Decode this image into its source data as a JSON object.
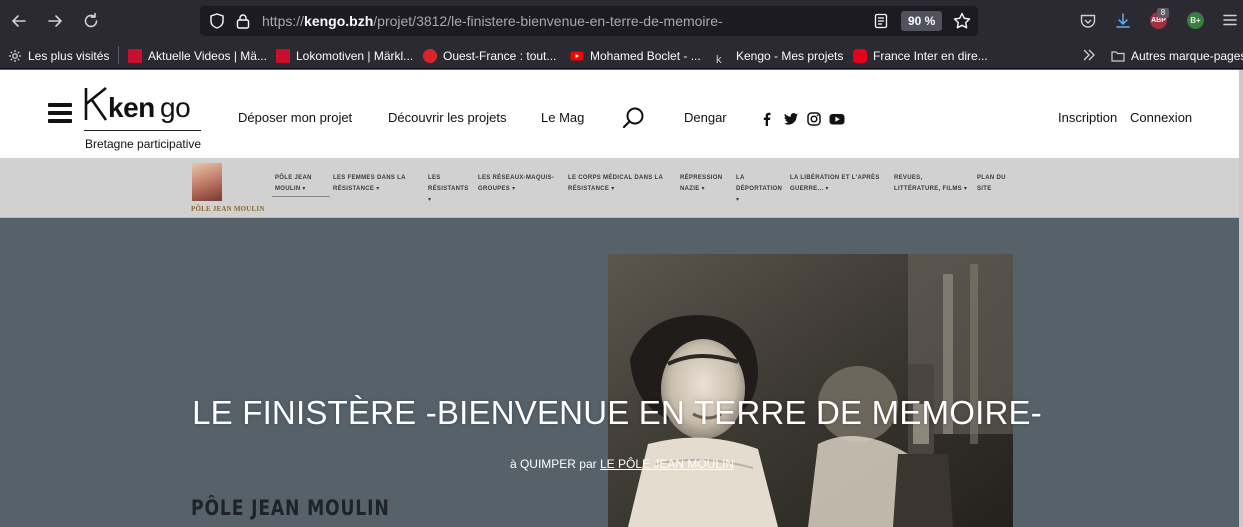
{
  "browser": {
    "url_prefix": "https://",
    "url_domain": "kengo.bzh",
    "url_path": "/projet/3812/le-finistere-bienvenue-en-terre-de-memoire-",
    "zoom": "90 %",
    "abp_label": "ABP",
    "abp_badge": "8",
    "bplus_label": "B+",
    "accent": "#2b2a33"
  },
  "bookmarks": [
    {
      "label": "Les plus visités"
    },
    {
      "label": "Aktuelle Videos | Mä..."
    },
    {
      "label": "Lokomotiven | Märkl..."
    },
    {
      "label": "Ouest-France : tout..."
    },
    {
      "label": "Mohamed Boclet - ..."
    },
    {
      "label": "Kengo - Mes projets"
    },
    {
      "label": "France Inter en dire..."
    },
    {
      "label": "Autres marque-pages"
    }
  ],
  "site": {
    "logo_tagline": "Bretagne participative",
    "nav": [
      {
        "label": "Déposer mon projet"
      },
      {
        "label": "Découvrir les projets"
      },
      {
        "label": "Le Mag"
      },
      {
        "label": "Dengar"
      }
    ],
    "auth": {
      "signup": "Inscription",
      "login": "Connexion"
    }
  },
  "subnav": {
    "logo_text": "PÔLE JEAN MOULIN",
    "items": [
      {
        "l1": "PÔLE JEAN",
        "l2": "MOULIN ▾",
        "l3": ""
      },
      {
        "l1": "LES FEMMES DANS LA",
        "l2": "RÉSISTANCE ▾",
        "l3": ""
      },
      {
        "l1": "LES",
        "l2": "RÉSISTANTS",
        "l3": "▾"
      },
      {
        "l1": "LES RÉSEAUX-MAQUIS-",
        "l2": "GROUPES ▾",
        "l3": ""
      },
      {
        "l1": "LE CORPS MÉDICAL DANS LA",
        "l2": "RÉSISTANCE ▾",
        "l3": ""
      },
      {
        "l1": "RÉPRESSION",
        "l2": "NAZIE ▾",
        "l3": ""
      },
      {
        "l1": "LA",
        "l2": "DÉPORTATION",
        "l3": "▾"
      },
      {
        "l1": "LA LIBÉRATION ET L'APRÈS",
        "l2": "GUERRE... ▾",
        "l3": ""
      },
      {
        "l1": "REVUES,",
        "l2": "LITTÉRATURE, FILMS ▾",
        "l3": ""
      },
      {
        "l1": "PLAN DU",
        "l2": "SITE",
        "l3": ""
      }
    ]
  },
  "hero": {
    "title": "LE FINISTÈRE -BIENVENUE EN TERRE DE MEMOIRE-",
    "byline_prefix": "à QUIMPER par ",
    "byline_author": "LE PÔLE JEAN MOULIN",
    "section_title": "PÔLE JEAN MOULIN"
  }
}
